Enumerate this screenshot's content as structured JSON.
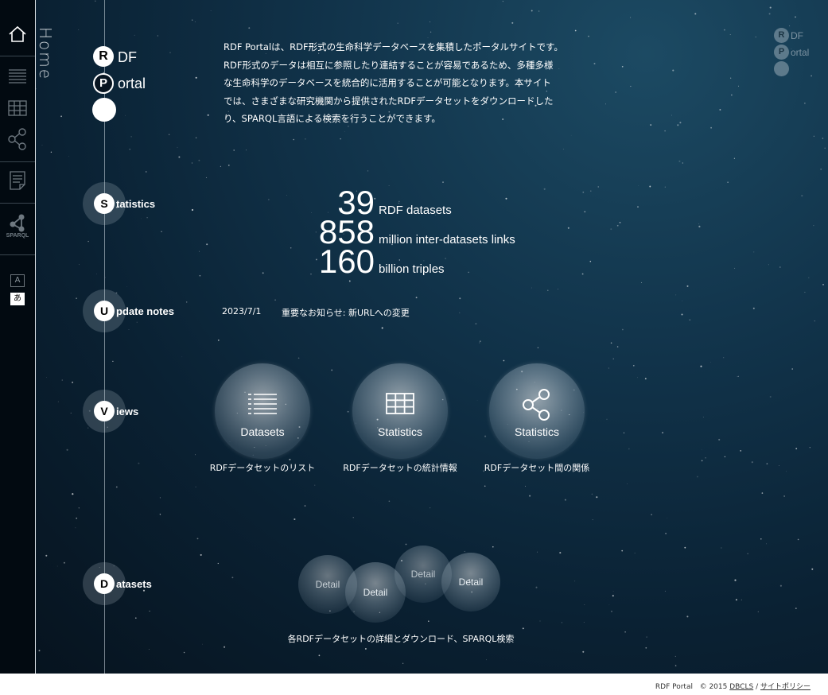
{
  "sidebar": {
    "page_label": "Home",
    "sparql_label": "SPARQL",
    "lang_en": "A",
    "lang_ja": "あ"
  },
  "logo": {
    "r": "R",
    "df": "DF",
    "p": "P",
    "ortal": "ortal"
  },
  "corner_logo": {
    "r": "R",
    "df": "DF",
    "p": "P",
    "ortal": "ortal"
  },
  "intro": {
    "lines": [
      "RDF Portalは、RDF形式の生命科学データベースを集積したポータルサイトです。",
      "RDF形式のデータは相互に参照したり連結することが容易であるため、多種多様",
      "な生命科学のデータベースを統合的に活用することが可能となります。本サイト",
      "では、さまざまな研究機関から提供されたRDFデータセットをダウンロードした",
      "り、SPARQL言語による検索を行うことができます。"
    ]
  },
  "sections": {
    "statistics": {
      "letter": "S",
      "rest": "tatistics"
    },
    "updates": {
      "letter": "U",
      "rest": "pdate notes"
    },
    "views": {
      "letter": "V",
      "rest": "iews"
    },
    "datasets": {
      "letter": "D",
      "rest": "atasets"
    }
  },
  "stats": [
    {
      "value": "39",
      "label": "RDF datasets"
    },
    {
      "value": "858",
      "label": "million inter-datasets links"
    },
    {
      "value": "160",
      "label": "billion triples"
    }
  ],
  "update_notes": [
    {
      "date": "2023/7/1",
      "text": "重要なお知らせ: 新URLへの変更"
    }
  ],
  "views": [
    {
      "label": "Datasets",
      "caption": "RDFデータセットのリスト",
      "icon": "list-icon"
    },
    {
      "label": "Statistics",
      "caption": "RDFデータセットの統計情報",
      "icon": "table-icon"
    },
    {
      "label": "Statistics",
      "caption": "RDFデータセット間の関係",
      "icon": "graph-icon"
    }
  ],
  "details": [
    {
      "label": "Detail"
    },
    {
      "label": "Detail"
    },
    {
      "label": "Detail"
    },
    {
      "label": "Detail"
    }
  ],
  "datasets_caption": "各RDFデータセットの詳細とダウンロード、SPARQL検索",
  "footer": {
    "site": "RDF Portal",
    "copyright": "© 2015",
    "org": "DBCLS",
    "sep": "/",
    "policy": "サイトポリシー"
  }
}
